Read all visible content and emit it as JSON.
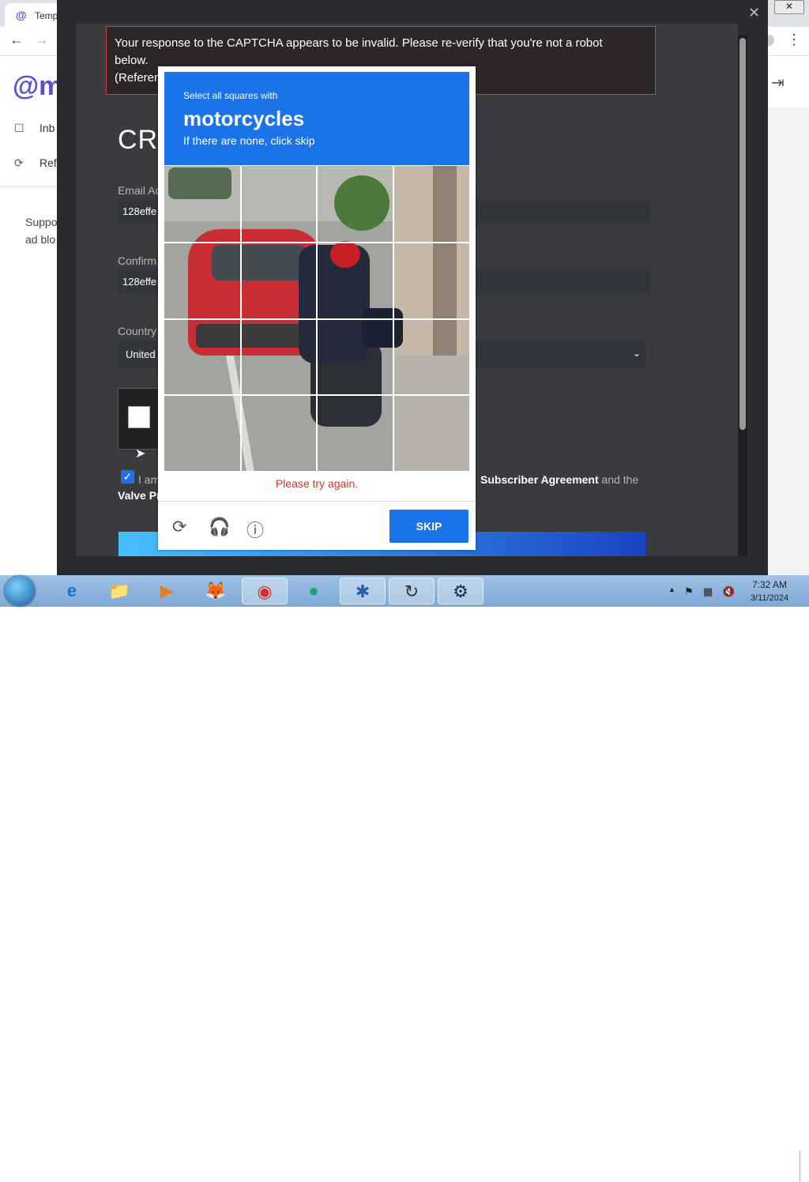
{
  "browser": {
    "tab_icon": "@",
    "tab_title": "Temp",
    "close_glyph": "✕",
    "back_glyph": "←",
    "forward_glyph": "→",
    "menu_glyph": "⋮",
    "logo_prefix": "@",
    "logo_text": "m",
    "sidebar": [
      {
        "icon": "inbox-icon",
        "glyph": "☐",
        "label": "Inb"
      },
      {
        "icon": "refresh-icon",
        "glyph": "⟳",
        "label": "Ref"
      }
    ],
    "support_text": [
      "Suppo",
      "ad blo"
    ],
    "logout_glyph": "⇥"
  },
  "overlay": {
    "close_glyph": "✕",
    "error_line1": "Your response to the CAPTCHA appears to be invalid. Please re-verify that you're not a robot",
    "error_line2": "below.",
    "error_line3": "(Referen",
    "heading": "CRI",
    "email_label": "Email Ad",
    "email_value": "128effe",
    "confirm_label": "Confirm",
    "confirm_value": "128effe",
    "country_label": "Country",
    "country_value": "United",
    "agree_text_1": "I am",
    "agree_text_2": "Valve Pr",
    "agree_right_bold": "Subscriber Agreement",
    "agree_right_rest": " and the",
    "checkbox_glyph": "✓"
  },
  "captcha": {
    "instruction_small": "Select all squares with",
    "target": "motorcycles",
    "instruction_sub": "If there are none, click skip",
    "error": "Please try again.",
    "reload_glyph": "⟳",
    "audio_glyph": "🎧",
    "info_glyph": "ⓘ",
    "skip_label": "SKIP"
  },
  "taskbar": {
    "time": "7:32 AM",
    "date": "3/11/2024",
    "apps": [
      {
        "name": "internet-explorer-icon",
        "glyph": "e"
      },
      {
        "name": "file-explorer-icon",
        "glyph": "📁"
      },
      {
        "name": "media-player-icon",
        "glyph": "▶"
      },
      {
        "name": "firefox-icon",
        "glyph": "🦊"
      },
      {
        "name": "chrome-icon",
        "glyph": "◉"
      },
      {
        "name": "app-green-icon",
        "glyph": "●"
      },
      {
        "name": "network-app-icon",
        "glyph": "✱"
      },
      {
        "name": "sync-app-icon",
        "glyph": "↻"
      },
      {
        "name": "steam-icon",
        "glyph": "⚙"
      }
    ],
    "tray": {
      "arrow": "▲",
      "flag": "⚑",
      "network": "▦",
      "volume": "🔇"
    }
  }
}
